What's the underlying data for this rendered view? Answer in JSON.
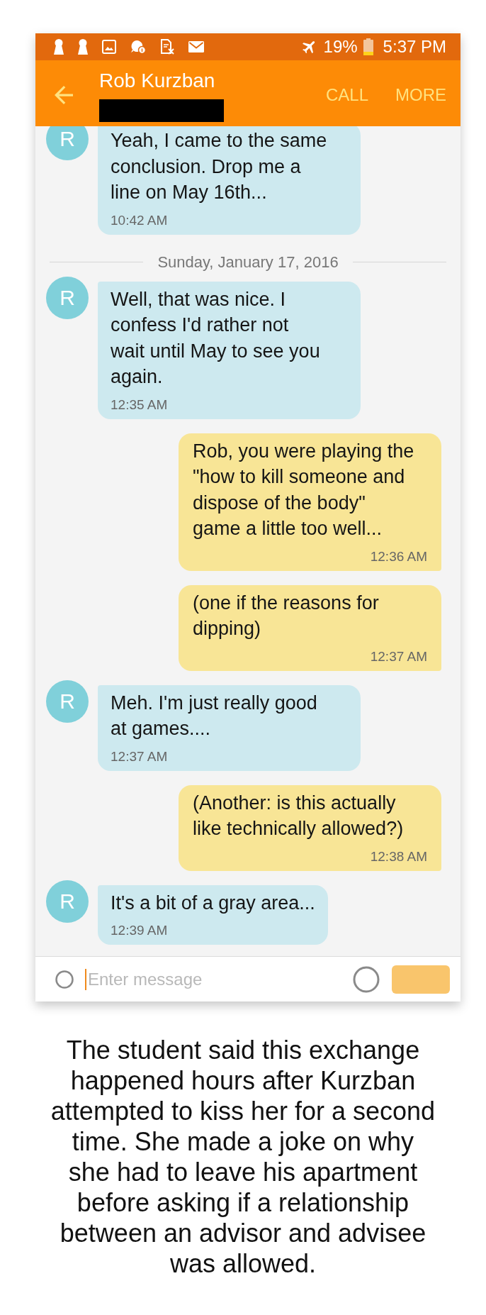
{
  "status_bar": {
    "battery": "19%",
    "time": "5:37 PM"
  },
  "header": {
    "contact_name": "Rob Kurzban",
    "actions": [
      "CALL",
      "MORE"
    ]
  },
  "messages": [
    {
      "kind": "received",
      "avatar": "R",
      "text": "Yeah, I came to the same\nconclusion. Drop me a\nline on May 16th...",
      "time": "10:42 AM"
    },
    {
      "kind": "date",
      "text": "Sunday, January 17, 2016"
    },
    {
      "kind": "received",
      "avatar": "R",
      "text": "Well, that was nice. I\nconfess I'd rather not\nwait until May to see you\nagain.",
      "time": "12:35 AM"
    },
    {
      "kind": "sent",
      "text": "Rob, you were playing the\n\"how to kill someone and\ndispose of the body\"\ngame a little too well...",
      "time": "12:36 AM"
    },
    {
      "kind": "sent",
      "text": "(one if the reasons for\ndipping)",
      "time": "12:37 AM"
    },
    {
      "kind": "received",
      "avatar": "R",
      "text": "Meh. I'm just really good\nat games....",
      "time": "12:37 AM"
    },
    {
      "kind": "sent",
      "text": "(Another: is this actually\nlike technically allowed?)",
      "time": "12:38 AM"
    },
    {
      "kind": "received",
      "avatar": "R",
      "text": "It's a bit of a gray area...",
      "time": "12:39 AM"
    }
  ],
  "composer": {
    "placeholder": "Enter message",
    "send_button": {
      "disabled": true
    }
  },
  "caption": "The student said this exchange\nhappened hours after Kurzban\nattempted to kiss her for a second\ntime. She made a joke on why\nshe had to leave his apartment\nbefore asking if a relationship\nbetween an advisor and advisee\nwas allowed."
}
